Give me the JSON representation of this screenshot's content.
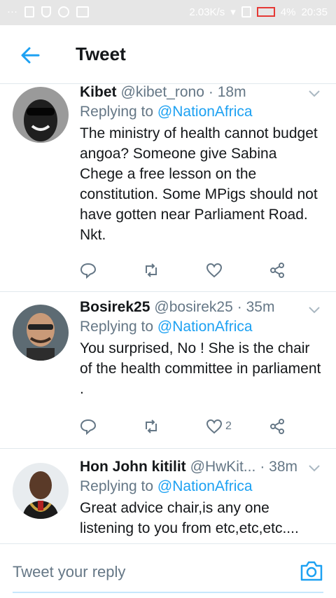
{
  "status_bar": {
    "dots": "···",
    "speed": "2.03K/s",
    "battery": "4%",
    "time": "20:35"
  },
  "header": {
    "title": "Tweet"
  },
  "tweets": [
    {
      "author": "Kibet",
      "handle": "@kibet_rono",
      "time": "· 18m",
      "replying_prefix": "Replying to",
      "replying_to": "@NationAfrica",
      "text": "The ministry of health cannot budget angoa? Someone give Sabina Chege a free lesson on the constitution. Some MPigs should not have gotten near Parliament Road. Nkt.",
      "likes": ""
    },
    {
      "author": "Bosirek25",
      "handle": "@bosirek25",
      "time": "· 35m",
      "replying_prefix": "Replying to",
      "replying_to": "@NationAfrica",
      "text": "You surprised,  No ! She is the chair of the health committee in parliament .",
      "likes": "2"
    },
    {
      "author": "Hon John kitilit",
      "handle": "@HwKit...",
      "time": "· 38m",
      "replying_prefix": "Replying to",
      "replying_to": "@NationAfrica",
      "text": "Great advice chair,is any one listening to you from etc,etc,etc....",
      "likes": ""
    }
  ],
  "reply_bar": {
    "placeholder": "Tweet your reply"
  },
  "colors": {
    "accent": "#1da1f2",
    "secondary_text": "#657786",
    "primary_text": "#14171a",
    "divider": "#e1e8ed"
  }
}
